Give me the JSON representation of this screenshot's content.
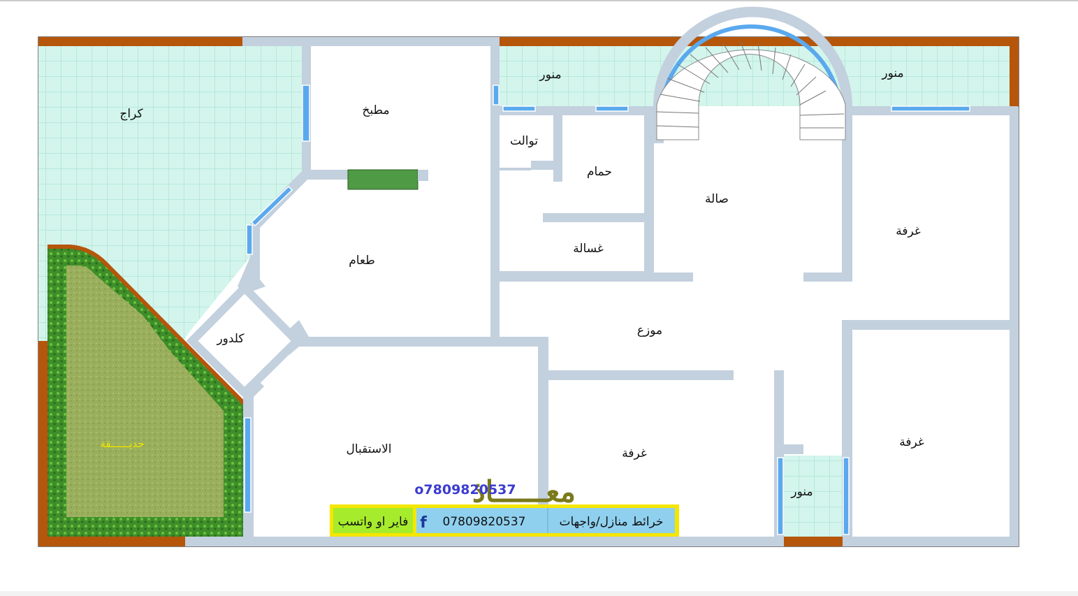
{
  "rooms": {
    "garage": "كراج",
    "kitchen": "مطبخ",
    "light_well_top_left": "منور",
    "light_well_top_right": "منور",
    "light_well_bottom": "منور",
    "toilet": "توالت",
    "bathroom": "حمام",
    "laundry": "غسالة",
    "living_hall": "صالة",
    "dining": "طعام",
    "corridor_entry": "كلدور",
    "distributor": "موزع",
    "reception": "الاستقبال",
    "bedroom_right_upper": "غرفة",
    "bedroom_right_lower": "غرفة",
    "bedroom_center": "غرفة",
    "garden": "حديــــــقة"
  },
  "signature": {
    "name": "معــــــاذ",
    "phone": "o7809820537"
  },
  "banner": {
    "contact_label": "فاير او واتسب",
    "facebook_glyph": "f",
    "phone": "07809820537",
    "service": "خرائط منازل/واجهات"
  },
  "colors": {
    "wall": "#c3d0de",
    "outer_wall": "#b5560b",
    "tile": "#d3f5ec",
    "window": "#5aa9ee",
    "garden": "#9aaf5a",
    "hedge": "#3c8a2a",
    "banner_border": "#f5e600",
    "banner_green": "#a7ec2c",
    "banner_blue": "#8fd0ef"
  }
}
